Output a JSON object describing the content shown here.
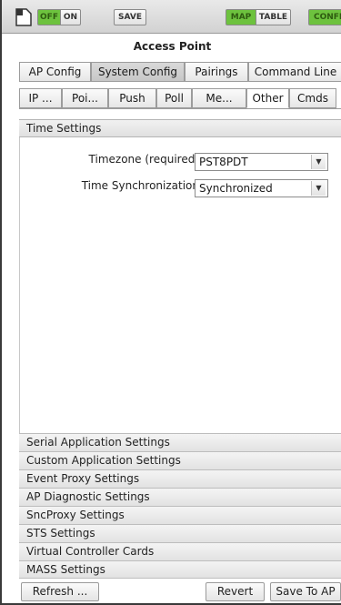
{
  "toolbar": {
    "off_label": "OFF",
    "on_label": "ON",
    "save_label": "SAVE",
    "map_label": "MAP",
    "table_label": "TABLE",
    "config_label": "CONFIG",
    "accent_green": "#6dc23e"
  },
  "title": "Access Point",
  "main_tabs": [
    "AP Config",
    "System Config",
    "Pairings",
    "Command Line"
  ],
  "sub_tabs": [
    "IP ...",
    "Poi...",
    "Push",
    "Poll",
    "Me...",
    "Other",
    "Cmds"
  ],
  "time_settings": {
    "header": "Time Settings",
    "timezone_label": "Timezone (required)",
    "timezone_value": "PST8PDT",
    "sync_label": "Time Synchronization",
    "sync_value": "Synchronized"
  },
  "accordion": [
    "Serial Application Settings",
    "Custom Application Settings",
    "Event Proxy Settings",
    "AP Diagnostic Settings",
    "SncProxy Settings",
    "STS Settings",
    "Virtual Controller Cards",
    "MASS Settings"
  ],
  "footer": {
    "refresh_label": "Refresh ...",
    "revert_label": "Revert",
    "save_to_ap_label": "Save To AP"
  }
}
